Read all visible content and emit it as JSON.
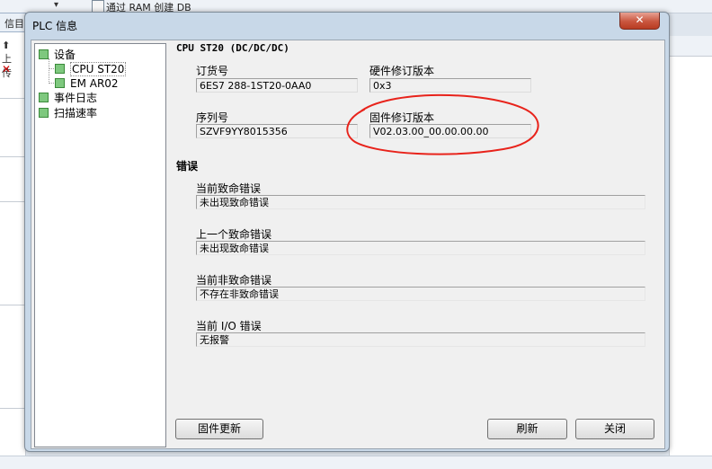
{
  "background": {
    "tab_label": "信目",
    "up_label": "上传",
    "ram_text": "通过 RAM 创建 DB"
  },
  "dialog": {
    "title": "PLC 信息",
    "close_symbol": "✕"
  },
  "tree": {
    "items": [
      {
        "label": "设备"
      },
      {
        "label": "CPU ST20"
      },
      {
        "label": "EM AR02"
      },
      {
        "label": "事件日志"
      },
      {
        "label": "扫描速率"
      }
    ]
  },
  "device": {
    "heading": "CPU ST20 (DC/DC/DC)",
    "order_label": "订货号",
    "order_value": "6ES7 288-1ST20-0AA0",
    "hw_label": "硬件修订版本",
    "hw_value": "0x3",
    "serial_label": "序列号",
    "serial_value": "SZVF9YY8015356",
    "fw_label": "固件修订版本",
    "fw_value": "V02.03.00_00.00.00.00"
  },
  "errors": {
    "title": "错误",
    "items": [
      {
        "label": "当前致命错误",
        "value": "未出现致命错误"
      },
      {
        "label": "上一个致命错误",
        "value": "未出现致命错误"
      },
      {
        "label": "当前非致命错误",
        "value": "不存在非致命错误"
      },
      {
        "label": "当前 I/O 错误",
        "value": "无报警"
      }
    ]
  },
  "buttons": {
    "firmware_update": "固件更新",
    "refresh": "刷新",
    "close": "关闭"
  },
  "colors": {
    "annotation": "#e8231b",
    "tree_box": "#7ec87e"
  }
}
